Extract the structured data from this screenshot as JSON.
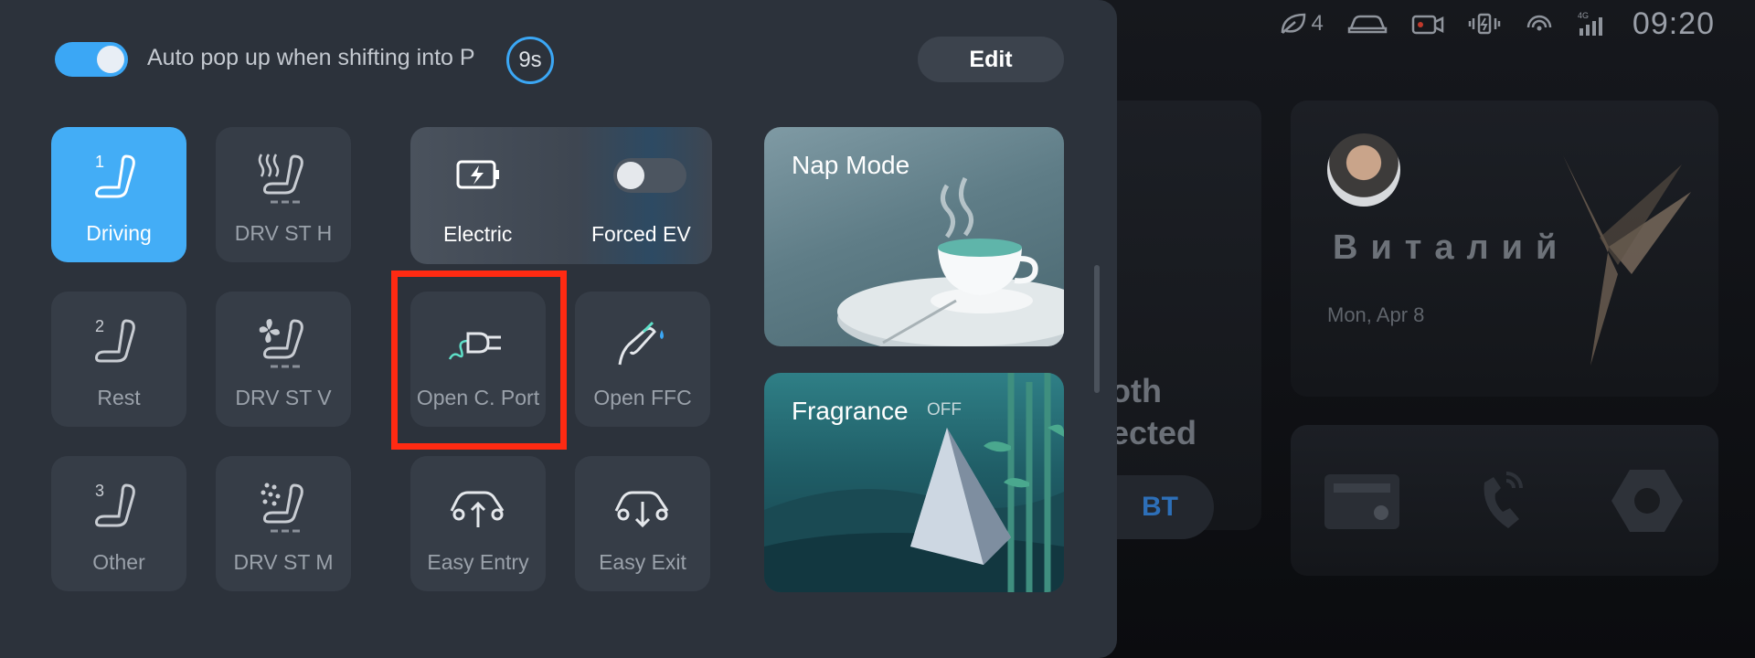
{
  "status_bar": {
    "eco_level": "4",
    "time": "09:20",
    "network": "4G"
  },
  "background": {
    "bluetooth_text": "oth\nected",
    "bt_button": "BT",
    "user_name": "Виталий",
    "user_date": "Mon, Apr 8"
  },
  "panel": {
    "auto_popup_label": "Auto pop up when shifting into P",
    "auto_popup_enabled": true,
    "timer": "9s",
    "edit_label": "Edit",
    "seat_tiles": [
      {
        "label": "Driving",
        "number": "1",
        "active": true
      },
      {
        "label": "DRV ST H",
        "active": false
      },
      {
        "label": "Rest",
        "number": "2",
        "active": false
      },
      {
        "label": "DRV ST V",
        "active": false
      },
      {
        "label": "Other",
        "number": "3",
        "active": false
      },
      {
        "label": "DRV ST M",
        "active": false
      }
    ],
    "power": {
      "electric_label": "Electric",
      "forced_ev_label": "Forced EV",
      "forced_ev_enabled": false
    },
    "action_tiles": [
      {
        "label": "Open C. Port"
      },
      {
        "label": "Open FFC"
      },
      {
        "label": "Easy Entry"
      },
      {
        "label": "Easy Exit"
      }
    ],
    "nap_mode": {
      "title": "Nap Mode"
    },
    "fragrance": {
      "title": "Fragrance",
      "state": "OFF"
    }
  },
  "colors": {
    "accent": "#43adf6",
    "panel_bg": "#2c323b",
    "tile_bg": "#363d47",
    "highlight": "#ff2a12"
  }
}
